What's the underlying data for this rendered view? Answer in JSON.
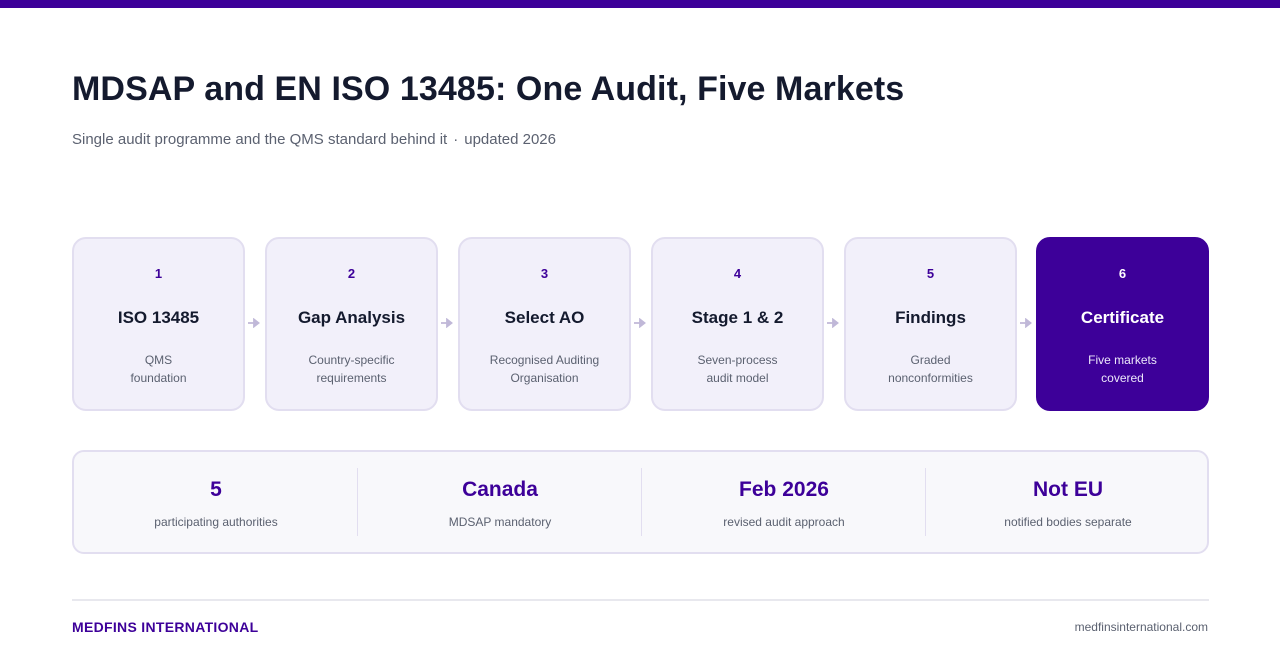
{
  "header": {
    "title": "MDSAP and EN ISO 13485: One Audit, Five Markets",
    "subtitle": "Single audit programme and the QMS standard behind it",
    "separator": "·",
    "updated": "updated 2026"
  },
  "steps": [
    {
      "number": "1",
      "title": "ISO 13485",
      "desc_line1": "QMS",
      "desc_line2": "foundation"
    },
    {
      "number": "2",
      "title": "Gap Analysis",
      "desc_line1": "Country-specific",
      "desc_line2": "requirements"
    },
    {
      "number": "3",
      "title": "Select AO",
      "desc_line1": "Recognised Auditing",
      "desc_line2": "Organisation"
    },
    {
      "number": "4",
      "title": "Stage 1 & 2",
      "desc_line1": "Seven-process",
      "desc_line2": "audit model"
    },
    {
      "number": "5",
      "title": "Findings",
      "desc_line1": "Graded",
      "desc_line2": "nonconformities"
    },
    {
      "number": "6",
      "title": "Certificate",
      "desc_line1": "Five markets",
      "desc_line2": "covered"
    }
  ],
  "stats": [
    {
      "value": "5",
      "label": "participating authorities"
    },
    {
      "value": "Canada",
      "label": "MDSAP mandatory"
    },
    {
      "value": "Feb 2026",
      "label": "revised audit approach"
    },
    {
      "value": "Not EU",
      "label": "notified bodies separate"
    }
  ],
  "footer": {
    "brand": "MEDFINS INTERNATIONAL",
    "website": "medfinsinternational.com"
  },
  "colors": {
    "accent": "#3d0099",
    "card_bg": "#f2f0fa",
    "card_border": "#e2def0",
    "text_dark": "#141a2e",
    "text_muted": "#5b6170",
    "arrow": "#c0b8d8"
  },
  "icons": {
    "connector": "arrow-right-icon"
  }
}
